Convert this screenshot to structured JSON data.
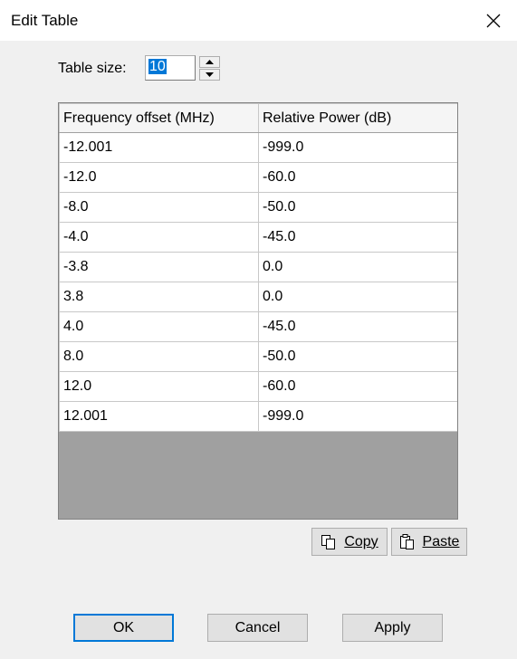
{
  "window": {
    "title": "Edit Table"
  },
  "table_size": {
    "label": "Table size:",
    "value": "10"
  },
  "table": {
    "headers": [
      "Frequency offset (MHz)",
      "Relative Power (dB)"
    ],
    "rows": [
      [
        "-12.001",
        "-999.0"
      ],
      [
        "-12.0",
        "-60.0"
      ],
      [
        "-8.0",
        "-50.0"
      ],
      [
        "-4.0",
        "-45.0"
      ],
      [
        "-3.8",
        "0.0"
      ],
      [
        "3.8",
        "0.0"
      ],
      [
        "4.0",
        "-45.0"
      ],
      [
        "8.0",
        "-50.0"
      ],
      [
        "12.0",
        "-60.0"
      ],
      [
        "12.001",
        "-999.0"
      ]
    ]
  },
  "clipboard": {
    "copy_label": "Copy",
    "paste_label": "Paste"
  },
  "footer": {
    "ok_label": "OK",
    "cancel_label": "Cancel",
    "apply_label": "Apply"
  },
  "colors": {
    "accent": "#0078d7",
    "grid_empty": "#a0a0a0"
  }
}
